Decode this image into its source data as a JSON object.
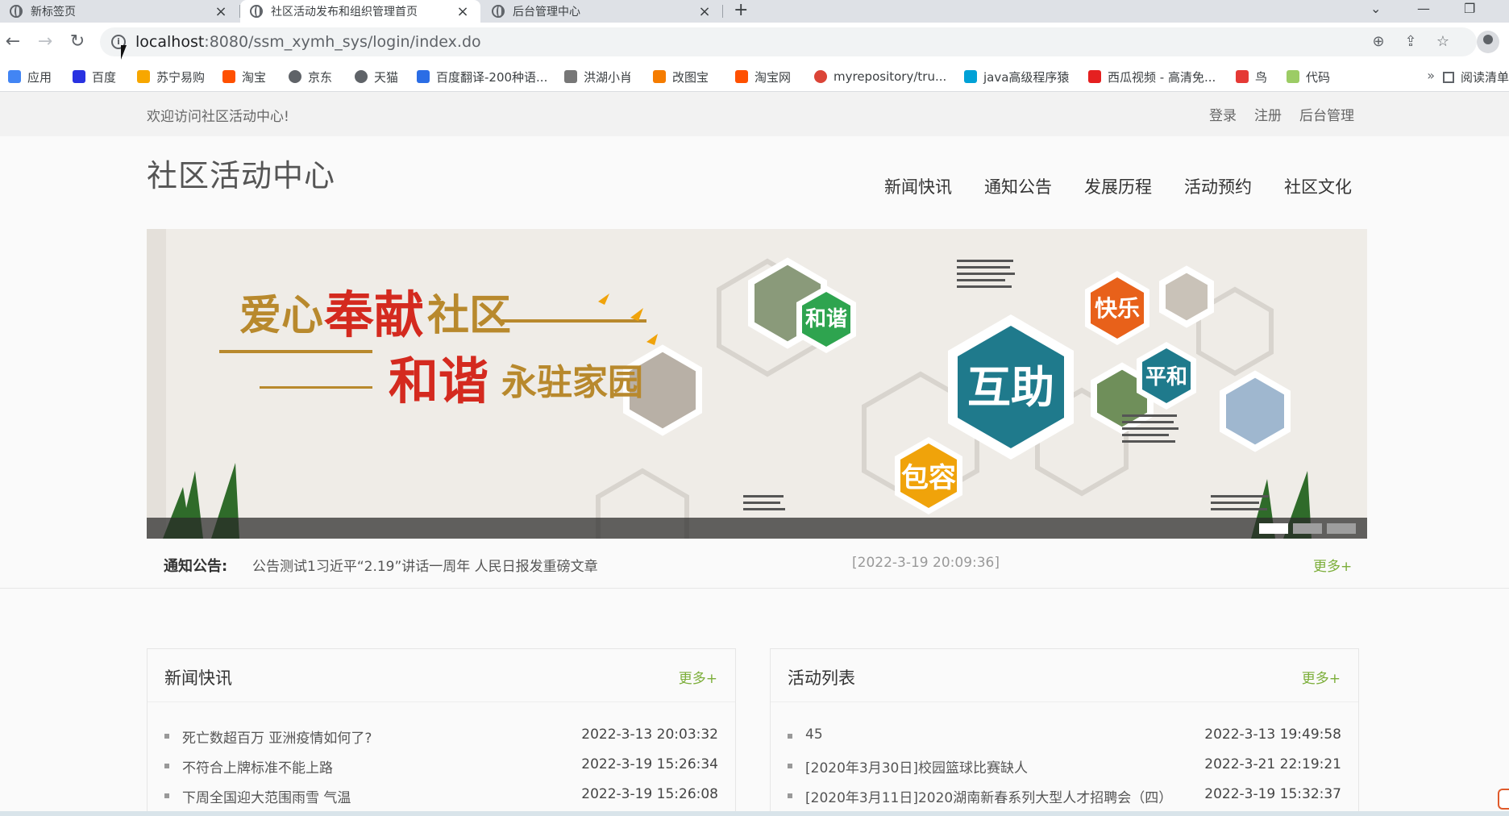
{
  "browser": {
    "tabs": [
      {
        "label": "新标签页",
        "active": false
      },
      {
        "label": "社区活动发布和组织管理首页",
        "active": true
      },
      {
        "label": "后台管理中心",
        "active": false
      }
    ],
    "new_tab": "+",
    "window_controls": {
      "dropdown": "⌄",
      "minimize": "—",
      "restore": "❐"
    },
    "nav": {
      "back": "←",
      "forward": "→",
      "reload": "↻"
    },
    "url_host": "localhost",
    "url_path": ":8080/ssm_xymh_sys/login/index.do",
    "bookmarks": [
      {
        "label": "应用",
        "icon": "apps-grid-icon",
        "color": "#4285f4"
      },
      {
        "label": "百度",
        "icon": "baidu-paw-icon",
        "color": "#2932e1"
      },
      {
        "label": "苏宁易购",
        "icon": "suning-icon",
        "color": "#f7a700"
      },
      {
        "label": "淘宝",
        "icon": "taobao-icon",
        "color": "#ff5000"
      },
      {
        "label": "京东",
        "icon": "globe-icon",
        "color": "#5f6368"
      },
      {
        "label": "天猫",
        "icon": "globe-icon",
        "color": "#5f6368"
      },
      {
        "label": "百度翻译-200种语...",
        "icon": "translate-icon",
        "color": "#2b6de5"
      },
      {
        "label": "洪湖小肖",
        "icon": "bird-icon",
        "color": "#777777"
      },
      {
        "label": "改图宝",
        "icon": "image-tool-icon",
        "color": "#f57c00"
      },
      {
        "label": "淘宝网",
        "icon": "taobao-icon",
        "color": "#ff5000"
      },
      {
        "label": "myrepository/tru...",
        "icon": "chrome-icon",
        "color": "#db4437"
      },
      {
        "label": "java高级程序猿",
        "icon": "bilibili-icon",
        "color": "#00a1d6"
      },
      {
        "label": "西瓜视频 - 高清免...",
        "icon": "play-icon",
        "color": "#e52020"
      },
      {
        "label": "鸟",
        "icon": "bird-icon",
        "color": "#e53935"
      },
      {
        "label": "代码",
        "icon": "code-icon",
        "color": "#9ccc65"
      }
    ],
    "bookmarks_more": "»",
    "reading_list": "阅读清单"
  },
  "site": {
    "welcome": "欢迎访问社区活动中心!",
    "top_links": [
      "登录",
      "注册",
      "后台管理"
    ],
    "logo": "社区活动中心",
    "main_nav": [
      "新闻快讯",
      "通知公告",
      "发展历程",
      "活动预约",
      "社区文化"
    ],
    "banner": {
      "slogan_line1_a": "爱心",
      "slogan_line1_b": "奉献",
      "slogan_line1_c": "社区",
      "slogan_line2_a": "和谐",
      "slogan_line2_b": "永驻家园",
      "hex_labels": [
        "和谐",
        "互助",
        "快乐",
        "平和",
        "包容"
      ],
      "slide_count": 3,
      "active_slide": 1
    },
    "notice": {
      "label": "通知公告:",
      "text": "公告测试1习近平“2.19”讲话一周年 人民日报发重磅文章",
      "date": "[2022-3-19 20:09:36]",
      "more": "更多+"
    },
    "news_panel": {
      "title": "新闻快讯",
      "more": "更多+",
      "items": [
        {
          "title": "死亡数超百万 亚洲疫情如何了?",
          "date": "2022-3-13 20:03:32"
        },
        {
          "title": "不符合上牌标准不能上路",
          "date": "2022-3-19 15:26:34"
        },
        {
          "title": "下周全国迎大范围雨雪 气温",
          "date": "2022-3-19 15:26:08"
        }
      ]
    },
    "activity_panel": {
      "title": "活动列表",
      "more": "更多+",
      "items": [
        {
          "title": "45",
          "date": "2022-3-13 19:49:58"
        },
        {
          "title": "[2020年3月30日]校园篮球比赛缺人",
          "date": "2022-3-21 22:19:21"
        },
        {
          "title": "[2020年3月11日]2020湖南新春系列大型人才招聘会（四）",
          "date": "2022-3-19 15:32:37"
        }
      ]
    }
  },
  "colors": {
    "accent_more": "#7cae3a",
    "hex_green": "#2ea44f",
    "hex_teal": "#1f7a8c",
    "hex_orange": "#e8611a",
    "hex_amber": "#f0a30a",
    "slogan_red": "#d42a1f",
    "slogan_gold": "#b8892d"
  }
}
